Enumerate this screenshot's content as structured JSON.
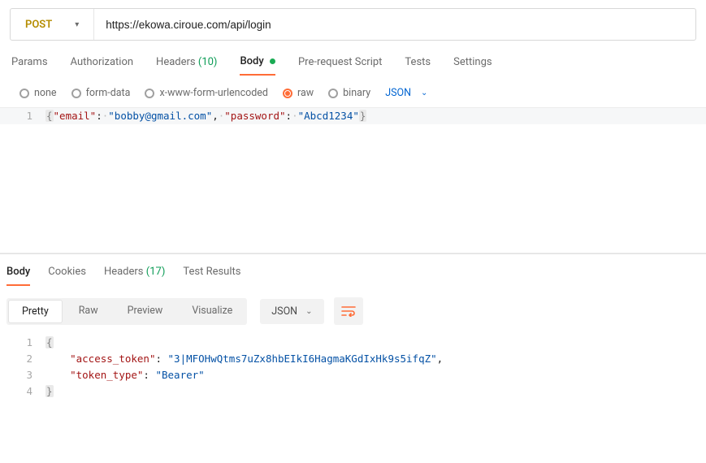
{
  "request": {
    "method": "POST",
    "url": "https://ekowa.ciroue.com/api/login"
  },
  "request_tabs": {
    "params": "Params",
    "authorization": "Authorization",
    "headers_label": "Headers",
    "headers_count": "(10)",
    "body": "Body",
    "prerequest": "Pre-request Script",
    "tests": "Tests",
    "settings": "Settings"
  },
  "body_types": {
    "none": "none",
    "formdata": "form-data",
    "xwww": "x-www-form-urlencoded",
    "raw": "raw",
    "binary": "binary",
    "json_select": "JSON"
  },
  "request_body": {
    "email_key": "\"email\"",
    "email_val": "\"bobby@gmail.com\"",
    "password_key": "\"password\"",
    "password_val": "\"Abcd1234\""
  },
  "response_tabs": {
    "body": "Body",
    "cookies": "Cookies",
    "headers_label": "Headers",
    "headers_count": "(17)",
    "test_results": "Test Results"
  },
  "format": {
    "pretty": "Pretty",
    "raw": "Raw",
    "preview": "Preview",
    "visualize": "Visualize",
    "lang": "JSON"
  },
  "response_body": {
    "token_key": "\"access_token\"",
    "token_val": "\"3|MFOHwQtms7uZx8hbEIkI6HagmaKGdIxHk9s5ifqZ\"",
    "type_key": "\"token_type\"",
    "type_val": "\"Bearer\""
  },
  "line_numbers": {
    "req1": "1",
    "r1": "1",
    "r2": "2",
    "r3": "3",
    "r4": "4"
  }
}
